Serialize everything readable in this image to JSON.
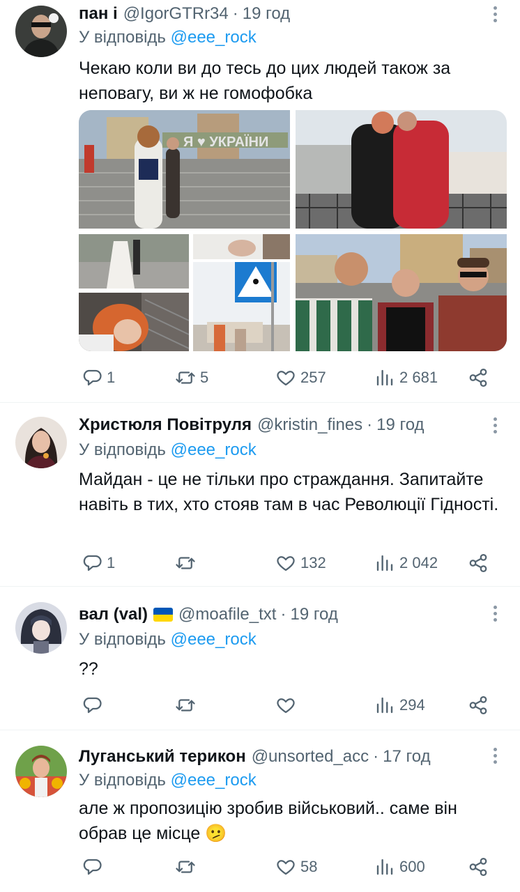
{
  "tweets": [
    {
      "name": "пан і",
      "handle": "@IgorGTRr34",
      "dot": "·",
      "time": "19 год",
      "reply_prefix": "У відповідь",
      "reply_mention": "@eee_rock",
      "text": "Чекаю коли ви до тесь до цих людей також за неповагу, ви ж не гомофобка",
      "media": [
        "photo",
        "photo",
        "photo",
        "photo",
        "photo",
        "photo"
      ],
      "stats": {
        "replies": "1",
        "retweets": "5",
        "likes": "257",
        "views": "2 681"
      }
    },
    {
      "name": "Христюля Повітруля",
      "handle": "@kristin_fines",
      "dot": "·",
      "time": "19 год",
      "reply_prefix": "У відповідь",
      "reply_mention": "@eee_rock",
      "text": "Майдан - це не тільки про страждання. Запитайте навіть в тих, хто стояв там в час Революції Гідності.",
      "stats": {
        "replies": "1",
        "retweets": "",
        "likes": "132",
        "views": "2 042"
      }
    },
    {
      "name": "вал (val)",
      "flag": "ukraine-flag",
      "handle": "@moafile_txt",
      "dot": "·",
      "time": "19 год",
      "reply_prefix": "У відповідь",
      "reply_mention": "@eee_rock",
      "text": "??",
      "stats": {
        "replies": "",
        "retweets": "",
        "likes": "",
        "views": "294"
      }
    },
    {
      "name": "Луганський терикон",
      "handle": "@unsorted_acc",
      "dot": "·",
      "time": "17 год",
      "reply_prefix": "У відповідь",
      "reply_mention": "@eee_rock",
      "text": "але ж пропозицію зробив військовий.. саме він обрав це місце 🫤",
      "stats": {
        "replies": "",
        "retweets": "",
        "likes": "58",
        "views": "600"
      }
    }
  ],
  "icons": {
    "reply": "reply-icon",
    "retweet": "retweet-icon",
    "like": "heart-icon",
    "views": "views-icon",
    "share": "share-icon",
    "more": "more-icon"
  },
  "colors": {
    "text": "#0f1419",
    "secondary": "#536471",
    "accent": "#1d9bf0",
    "divider": "#eff3f4"
  }
}
